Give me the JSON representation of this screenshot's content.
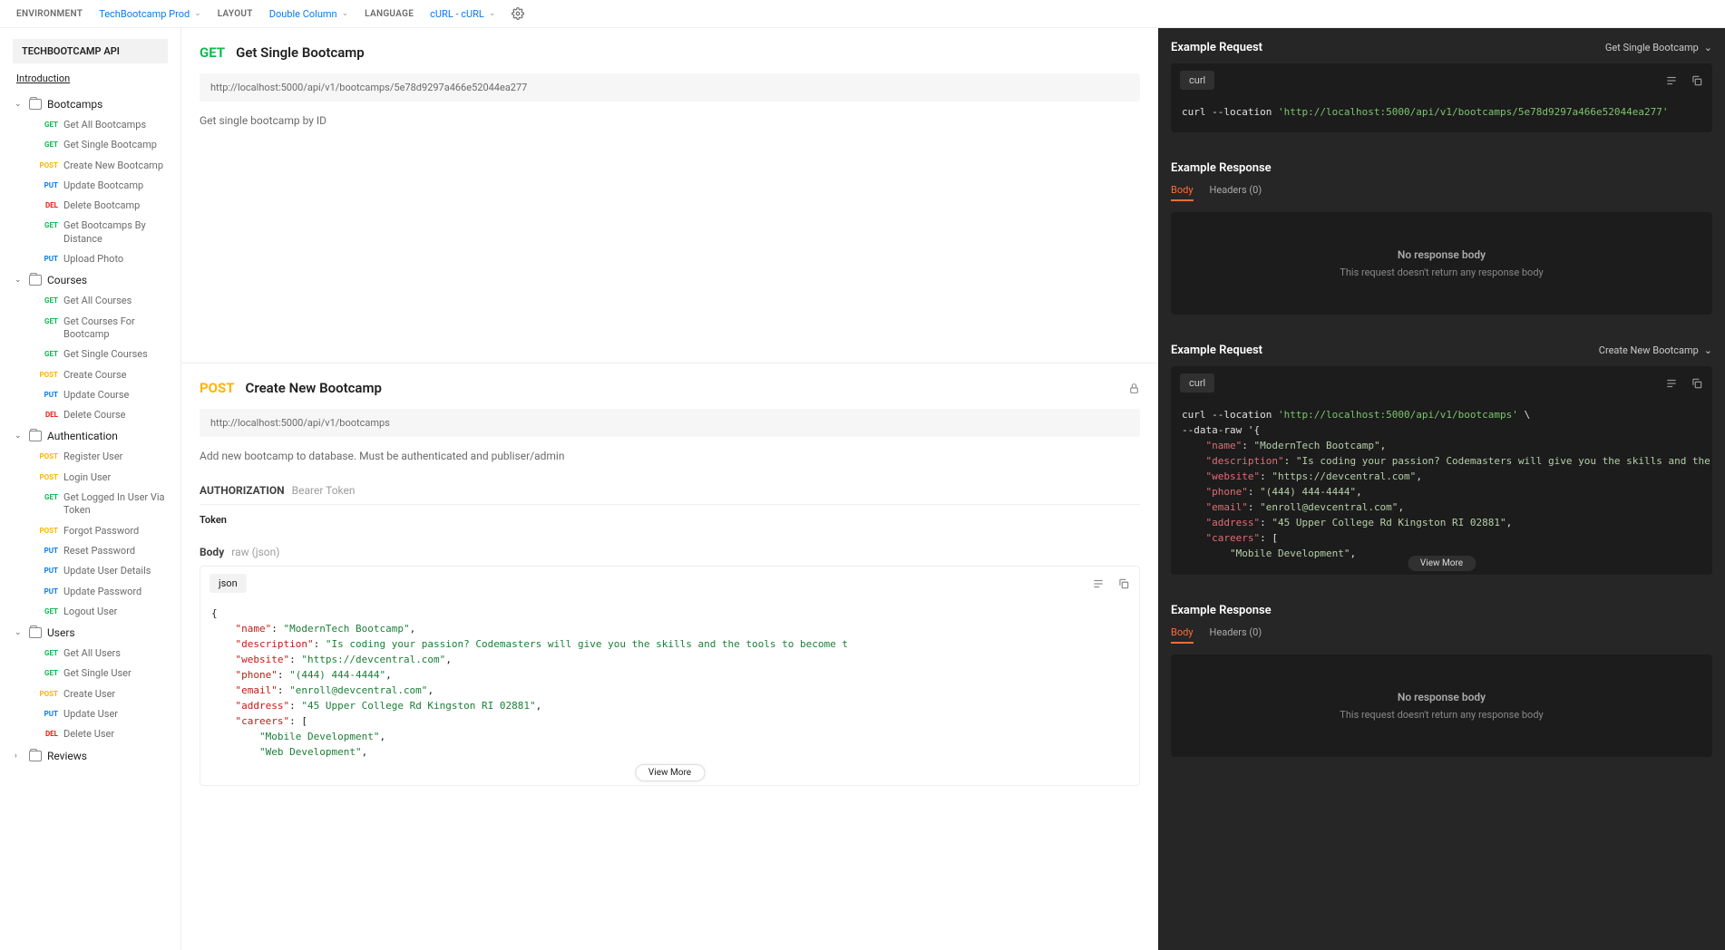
{
  "topbar": {
    "env_label": "ENVIRONMENT",
    "env_value": "TechBootcamp Prod",
    "layout_label": "LAYOUT",
    "layout_value": "Double Column",
    "lang_label": "LANGUAGE",
    "lang_value": "cURL - cURL"
  },
  "sidebar": {
    "api_title": "TECHBOOTCAMP API",
    "intro": "Introduction",
    "folders": [
      {
        "name": "Bootcamps",
        "items": [
          {
            "method": "GET",
            "name": "Get All Bootcamps"
          },
          {
            "method": "GET",
            "name": "Get Single Bootcamp"
          },
          {
            "method": "POST",
            "name": "Create New Bootcamp"
          },
          {
            "method": "PUT",
            "name": "Update Bootcamp"
          },
          {
            "method": "DEL",
            "name": "Delete Bootcamp"
          },
          {
            "method": "GET",
            "name": "Get Bootcamps By Distance"
          },
          {
            "method": "PUT",
            "name": "Upload Photo"
          }
        ]
      },
      {
        "name": "Courses",
        "items": [
          {
            "method": "GET",
            "name": "Get All Courses"
          },
          {
            "method": "GET",
            "name": "Get Courses For Bootcamp"
          },
          {
            "method": "GET",
            "name": "Get Single Courses"
          },
          {
            "method": "POST",
            "name": "Create Course"
          },
          {
            "method": "PUT",
            "name": "Update Course"
          },
          {
            "method": "DEL",
            "name": "Delete Course"
          }
        ]
      },
      {
        "name": "Authentication",
        "items": [
          {
            "method": "POST",
            "name": "Register User"
          },
          {
            "method": "POST",
            "name": "Login User"
          },
          {
            "method": "GET",
            "name": "Get Logged In User Via Token"
          },
          {
            "method": "POST",
            "name": "Forgot Password"
          },
          {
            "method": "PUT",
            "name": "Reset Password"
          },
          {
            "method": "PUT",
            "name": "Update User Details"
          },
          {
            "method": "PUT",
            "name": "Update Password"
          },
          {
            "method": "GET",
            "name": "Logout User"
          }
        ]
      },
      {
        "name": "Users",
        "items": [
          {
            "method": "GET",
            "name": "Get All Users"
          },
          {
            "method": "GET",
            "name": "Get Single User"
          },
          {
            "method": "POST",
            "name": "Create User"
          },
          {
            "method": "PUT",
            "name": "Update User"
          },
          {
            "method": "DEL",
            "name": "Delete User"
          }
        ]
      },
      {
        "name": "Reviews",
        "collapsed": true,
        "items": []
      }
    ]
  },
  "doc": {
    "sec1": {
      "method": "GET",
      "title": "Get Single Bootcamp",
      "url": "http://localhost:5000/api/v1/bootcamps/5e78d9297a466e52044ea277",
      "desc": "Get single bootcamp by ID"
    },
    "sec2": {
      "method": "POST",
      "title": "Create New Bootcamp",
      "url": "http://localhost:5000/api/v1/bootcamps",
      "desc": "Add new bootcamp to database. Must be authenticated and publiser/admin",
      "auth_label": "AUTHORIZATION",
      "auth_type": "Bearer Token",
      "token_label": "Token",
      "body_label": "Body",
      "body_type": "raw (json)",
      "json_tab": "json",
      "view_more": "View More",
      "json_lines": [
        {
          "indent": 0,
          "type": "punc",
          "text": "{"
        },
        {
          "indent": 1,
          "type": "kv",
          "key": "\"name\"",
          "val": "\"ModernTech Bootcamp\"",
          "comma": true
        },
        {
          "indent": 1,
          "type": "kv",
          "key": "\"description\"",
          "val": "\"Is coding your passion? Codemasters will give you the skills and the tools to become t",
          "comma": false
        },
        {
          "indent": 1,
          "type": "kv",
          "key": "\"website\"",
          "val": "\"https://devcentral.com\"",
          "comma": true
        },
        {
          "indent": 1,
          "type": "kv",
          "key": "\"phone\"",
          "val": "\"(444) 444-4444\"",
          "comma": true
        },
        {
          "indent": 1,
          "type": "kv",
          "key": "\"email\"",
          "val": "\"enroll@devcentral.com\"",
          "comma": true
        },
        {
          "indent": 1,
          "type": "kv",
          "key": "\"address\"",
          "val": "\"45 Upper College Rd Kingston RI 02881\"",
          "comma": true
        },
        {
          "indent": 1,
          "type": "kopen",
          "key": "\"careers\"",
          "open": "["
        },
        {
          "indent": 2,
          "type": "str",
          "val": "\"Mobile Development\"",
          "comma": true
        },
        {
          "indent": 2,
          "type": "str",
          "val": "\"Web Development\"",
          "comma": true
        }
      ]
    }
  },
  "dark": {
    "ex_req": "Example Request",
    "ex_res": "Example Response",
    "sel1": "Get Single Bootcamp",
    "sel2": "Create New Bootcamp",
    "curl_tab": "curl",
    "body_tab": "Body",
    "headers_tab": "Headers (0)",
    "no_body_title": "No response body",
    "no_body_sub": "This request doesn't return any response body",
    "view_more": "View More",
    "code1_lines": [
      {
        "type": "cmdurl",
        "cmd": "curl --location ",
        "url": "'http://localhost:5000/api/v1/bootcamps/5e78d9297a466e52044ea277'"
      }
    ],
    "code2_lines": [
      {
        "type": "cmdurl",
        "cmd": "curl --location ",
        "url": "'http://localhost:5000/api/v1/bootcamps'",
        "trail": " \\"
      },
      {
        "type": "raw",
        "text": "--data-raw '{"
      },
      {
        "type": "kv",
        "indent": 1,
        "key": "\"name\"",
        "val": "\"ModernTech Bootcamp\"",
        "comma": true
      },
      {
        "type": "kv",
        "indent": 1,
        "key": "\"description\"",
        "val": "\"Is coding your passion? Codemasters will give you the skills and the tools to become th",
        "comma": false
      },
      {
        "type": "kv",
        "indent": 1,
        "key": "\"website\"",
        "val": "\"https://devcentral.com\"",
        "comma": true
      },
      {
        "type": "kv",
        "indent": 1,
        "key": "\"phone\"",
        "val": "\"(444) 444-4444\"",
        "comma": true
      },
      {
        "type": "kv",
        "indent": 1,
        "key": "\"email\"",
        "val": "\"enroll@devcentral.com\"",
        "comma": true
      },
      {
        "type": "kv",
        "indent": 1,
        "key": "\"address\"",
        "val": "\"45 Upper College Rd Kingston RI 02881\"",
        "comma": true
      },
      {
        "type": "kopen",
        "indent": 1,
        "key": "\"careers\"",
        "open": "["
      },
      {
        "type": "str",
        "indent": 2,
        "val": "\"Mobile Development\"",
        "comma": true
      }
    ]
  }
}
